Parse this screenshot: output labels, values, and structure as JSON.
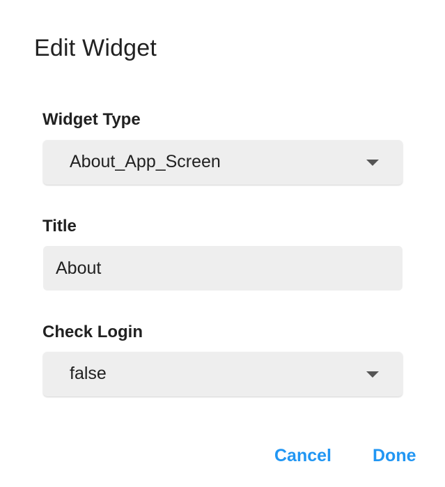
{
  "dialog": {
    "title": "Edit Widget"
  },
  "fields": {
    "widget_type": {
      "label": "Widget Type",
      "value": "About_App_Screen"
    },
    "title": {
      "label": "Title",
      "value": "About"
    },
    "check_login": {
      "label": "Check Login",
      "value": "false"
    }
  },
  "actions": {
    "cancel_label": "Cancel",
    "done_label": "Done"
  },
  "colors": {
    "accent": "#2196f3",
    "field_background": "#eeeeee",
    "text": "#212121"
  },
  "icons": {
    "dropdown": "caret-down-icon"
  }
}
